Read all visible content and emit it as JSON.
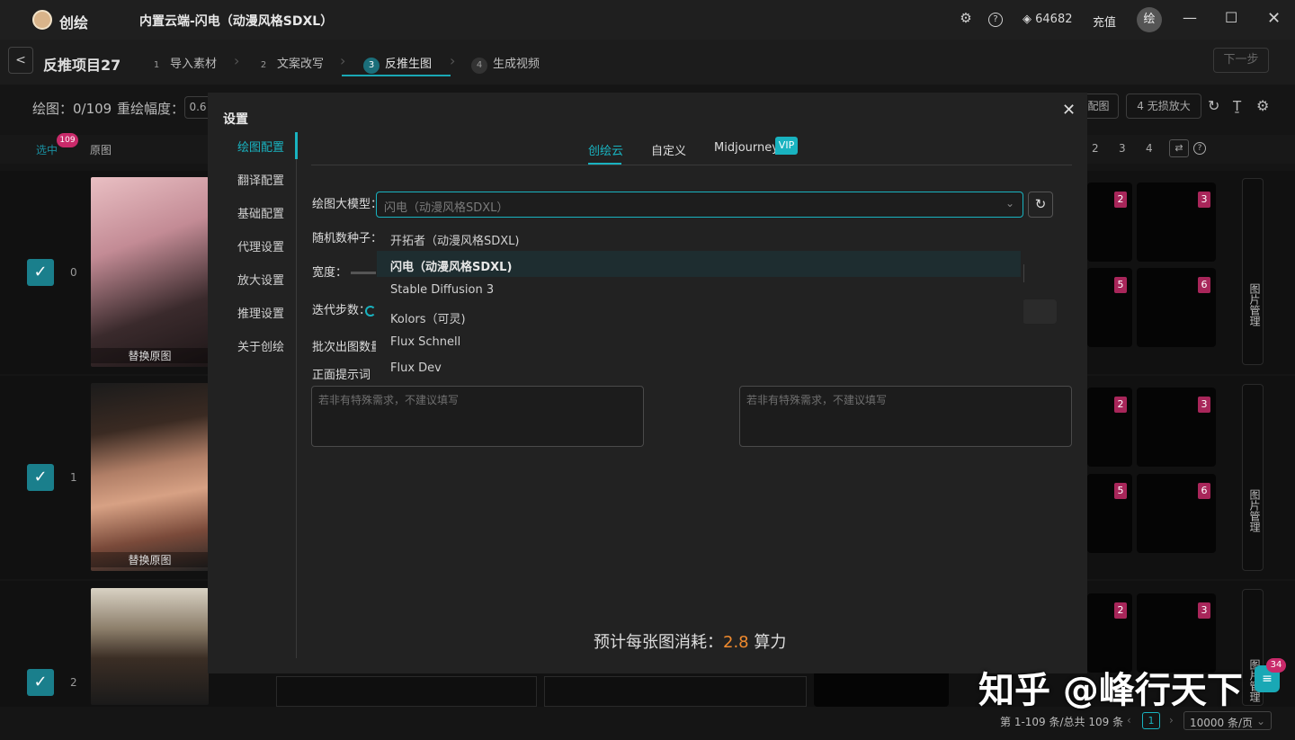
{
  "app": {
    "name": "创绘",
    "window_title": "内置云端-闪电（动漫风格SDXL）",
    "coins": "64682",
    "recharge": "充值",
    "avatar": "绘"
  },
  "project": {
    "name": "反推项目27",
    "next": "下一步"
  },
  "steps": [
    {
      "num": "1",
      "label": "导入素材"
    },
    {
      "num": "2",
      "label": "文案改写"
    },
    {
      "num": "3",
      "label": "反推生图"
    },
    {
      "num": "4",
      "label": "生成视频"
    }
  ],
  "toolbar": {
    "draw_count": "绘图：0/109",
    "redraw_label": "重绘幅度：",
    "redraw_value": "0.6",
    "match_label": "配图",
    "upscale_label": "4 无损放大"
  },
  "grid_header": {
    "selected": "选中",
    "selected_count": "109",
    "original": "原图",
    "pages": [
      "2",
      "3",
      "4"
    ]
  },
  "rows": [
    {
      "index": "0",
      "replace": "替换原图",
      "badges": [
        "2",
        "3",
        "5",
        "6"
      ]
    },
    {
      "index": "1",
      "replace": "替换原图",
      "badges": [
        "2",
        "3",
        "5",
        "6"
      ]
    },
    {
      "index": "2",
      "replace": "",
      "badges": [
        "2",
        "3"
      ]
    }
  ],
  "image_manager": "图片管理",
  "pagination": {
    "text": "第 1-109 条/总共 109 条",
    "page": "1",
    "per_page": "10000 条/页"
  },
  "modal": {
    "title": "设置",
    "nav": [
      "绘图配置",
      "翻译配置",
      "基础配置",
      "代理设置",
      "放大设置",
      "推理设置",
      "关于创绘"
    ],
    "tabs": [
      "创绘云",
      "自定义",
      "Midjourney"
    ],
    "vip": "VIP",
    "model_label": "绘图大模型：",
    "model_value": "闪电（动漫风格SDXL）",
    "seed_label": "随机数种子：",
    "width_label": "宽度：",
    "steps_label": "迭代步数：",
    "batch_label": "批次出图数量",
    "prompt_label": "正面提示词",
    "options": [
      "开拓者（动漫风格SDXL)",
      "闪电（动漫风格SDXL)",
      "Stable Diffusion 3",
      "Kolors（可灵)",
      "Flux Schnell",
      "Flux Dev"
    ],
    "positive_placeholder": "若非有特殊需求，不建议填写",
    "negative_placeholder": "若非有特殊需求，不建议填写",
    "cost_prefix": "预计每张图消耗：",
    "cost_value": "2.8",
    "cost_suffix": "算力"
  },
  "watermark": "知乎 @峰行天下",
  "chat_badge": "34",
  "colors": {
    "accent": "#19b3c0",
    "badge": "#a8265a",
    "cost": "#f08a2e"
  }
}
